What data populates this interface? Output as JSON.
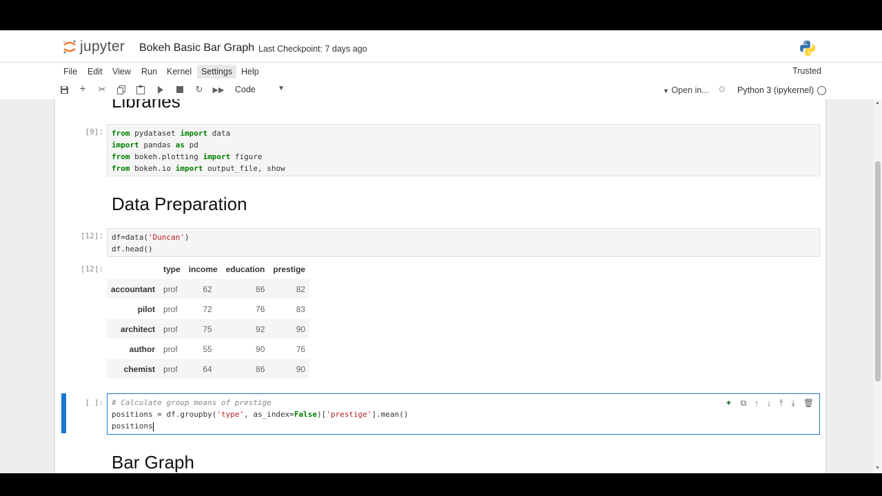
{
  "app": {
    "logo_text": "jupyter",
    "notebook_title": "Bokeh Basic Bar Graph",
    "checkpoint": "Last Checkpoint: 7 days ago"
  },
  "menu": {
    "items": [
      "File",
      "Edit",
      "View",
      "Run",
      "Kernel",
      "Settings",
      "Help"
    ],
    "trusted": "Trusted"
  },
  "toolbar": {
    "cell_type": "Code",
    "open_in": "Open in...",
    "kernel_name": "Python 3 (ipykernel)"
  },
  "cells": {
    "libraries_heading": "Libraries",
    "c1_prompt": "[9]:",
    "c1_lines": [
      [
        "from",
        " pydataset ",
        "import",
        " data"
      ],
      [
        "import",
        " pandas ",
        "as",
        " pd"
      ],
      [
        "from",
        " bokeh.plotting ",
        "import",
        " figure"
      ],
      [
        "from",
        " bokeh.io ",
        "import",
        " output_file, show"
      ]
    ],
    "data_prep_heading": "Data Preparation",
    "c2_prompt": "[12]:",
    "c2_line1_pre": "df=data(",
    "c2_line1_str": "'Duncan'",
    "c2_line1_post": ")",
    "c2_line2": "df.head()",
    "out_prompt": "[12]:",
    "table": {
      "columns": [
        "",
        "type",
        "income",
        "education",
        "prestige"
      ],
      "rows": [
        [
          "accountant",
          "prof",
          "62",
          "86",
          "82"
        ],
        [
          "pilot",
          "prof",
          "72",
          "76",
          "83"
        ],
        [
          "architect",
          "prof",
          "75",
          "92",
          "90"
        ],
        [
          "author",
          "prof",
          "55",
          "90",
          "76"
        ],
        [
          "chemist",
          "prof",
          "64",
          "86",
          "90"
        ]
      ]
    },
    "c3_prompt": "[ ]:",
    "c3_comment": "# Calculate group means of prestige",
    "c3_l2_a": "positions = df.groupby(",
    "c3_l2_b": "'type'",
    "c3_l2_c": ", as_index=",
    "c3_l2_d": "False",
    "c3_l2_e": ")[",
    "c3_l2_f": "'prestige'",
    "c3_l2_g": "].mean()",
    "c3_l3": "positions",
    "bar_graph_heading": "Bar Graph"
  },
  "colors": {
    "accent": "#1976d2",
    "keyword": "#008000",
    "string": "#ba2121"
  }
}
